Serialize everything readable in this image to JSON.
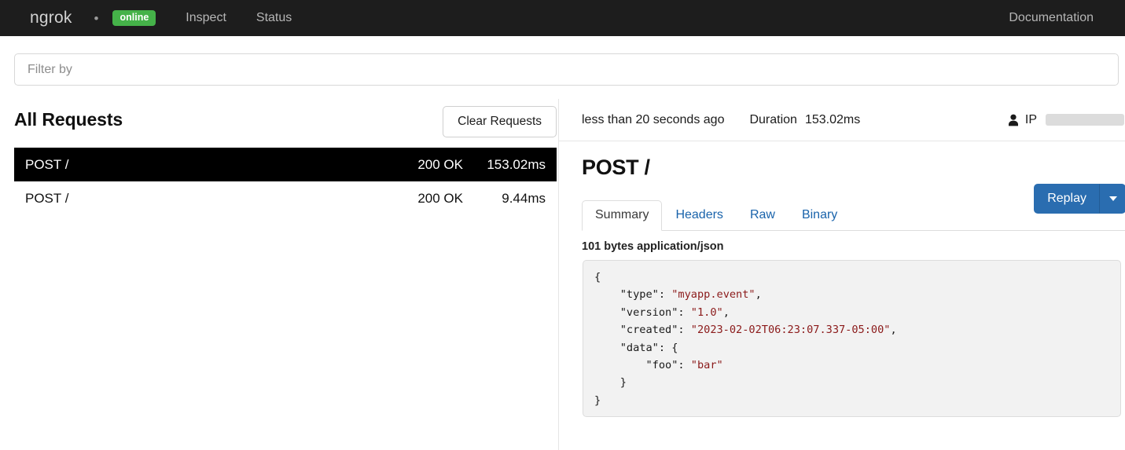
{
  "navbar": {
    "brand": "ngrok",
    "dot": "•",
    "status_badge": "online",
    "links": [
      {
        "label": "Inspect"
      },
      {
        "label": "Status"
      }
    ],
    "documentation": "Documentation",
    "colors": {
      "background": "#1d1d1d",
      "badge_green": "#45b249",
      "link": "#b6b6b6"
    }
  },
  "filter": {
    "placeholder": "Filter by",
    "value": ""
  },
  "requests_panel": {
    "title": "All Requests",
    "clear_button": "Clear Requests",
    "columns": [
      "method_path",
      "status",
      "duration"
    ],
    "rows": [
      {
        "method_path": "POST /",
        "status": "200 OK",
        "duration": "153.02ms",
        "selected": true
      },
      {
        "method_path": "POST /",
        "status": "200 OK",
        "duration": "9.44ms",
        "selected": false
      }
    ]
  },
  "detail_panel": {
    "meta": {
      "time_ago": "less than 20 seconds ago",
      "duration_label": "Duration",
      "duration_value": "153.02ms",
      "ip_label": "IP",
      "ip_value": "",
      "ip_redacted": true
    },
    "title": "POST /",
    "tabs": [
      {
        "label": "Summary",
        "active": true
      },
      {
        "label": "Headers",
        "active": false
      },
      {
        "label": "Raw",
        "active": false
      },
      {
        "label": "Binary",
        "active": false
      }
    ],
    "replay": {
      "label": "Replay",
      "caret_icon": "chevron-down-icon",
      "color": "#2a6db0"
    },
    "body_meta": "101 bytes application/json",
    "body_json": {
      "type": "myapp.event",
      "version": "1.0",
      "created": "2023-02-02T06:23:07.337-05:00",
      "data": {
        "foo": "bar"
      }
    },
    "body_lines": [
      {
        "indent": 0,
        "key": "",
        "text": "{"
      },
      {
        "indent": 1,
        "key": "\"type\":",
        "value": "\"myapp.event\"",
        "comma": ","
      },
      {
        "indent": 1,
        "key": "\"version\":",
        "value": "\"1.0\"",
        "comma": ","
      },
      {
        "indent": 1,
        "key": "\"created\":",
        "value": "\"2023-02-02T06:23:07.337-05:00\"",
        "comma": ","
      },
      {
        "indent": 1,
        "key": "\"data\":",
        "text": "{"
      },
      {
        "indent": 2,
        "key": "\"foo\":",
        "value": "\"bar\"",
        "comma": ""
      },
      {
        "indent": 1,
        "text": "}"
      },
      {
        "indent": 0,
        "text": "}"
      }
    ]
  }
}
